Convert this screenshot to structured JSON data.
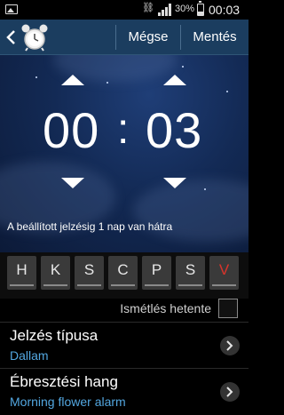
{
  "status_bar": {
    "battery_text": "30%",
    "battery_level": 0.3,
    "time": "00:03",
    "icons": [
      "image-notification-icon",
      "usb-icon",
      "signal-icon",
      "battery-icon"
    ]
  },
  "action_bar": {
    "cancel_label": "Mégse",
    "save_label": "Mentés",
    "icons": [
      "back-icon",
      "alarm-clock-icon"
    ]
  },
  "picker": {
    "hours": "00",
    "separator": ":",
    "minutes": "03",
    "remaining_text": "A beállított jelzésig 1 nap van hátra"
  },
  "days": [
    {
      "label": "H",
      "highlight": false
    },
    {
      "label": "K",
      "highlight": false
    },
    {
      "label": "S",
      "highlight": false
    },
    {
      "label": "C",
      "highlight": false
    },
    {
      "label": "P",
      "highlight": false
    },
    {
      "label": "S",
      "highlight": false
    },
    {
      "label": "V",
      "highlight": true
    }
  ],
  "repeat": {
    "label": "Ismétlés hetente",
    "checked": false
  },
  "settings": [
    {
      "title": "Jelzés típusa",
      "value": "Dallam"
    },
    {
      "title": "Ébresztési hang",
      "value": "Morning flower alarm"
    }
  ],
  "colors": {
    "action_bar": "#1b3d5f",
    "value_text": "#53a7e0",
    "sunday": "#d9342b"
  }
}
